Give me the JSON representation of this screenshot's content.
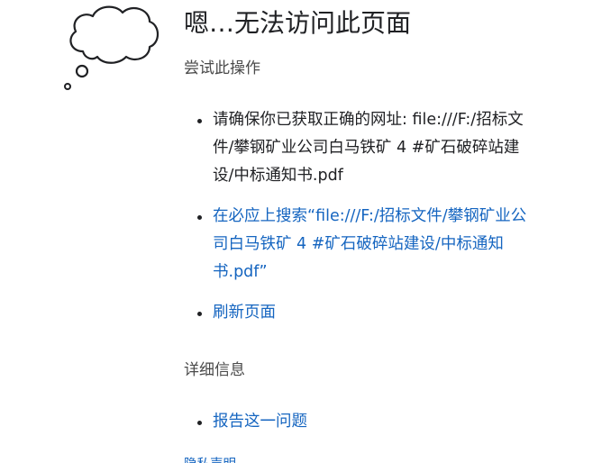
{
  "error_page": {
    "title": "嗯…无法访问此页面",
    "try_heading": "尝试此操作",
    "suggestions": [
      {
        "text": "请确保你已获取正确的网址: file:///F:/招标文件/攀钢矿业公司白马铁矿 4 #矿石破碎站建设/中标通知书.pdf",
        "is_link": false
      },
      {
        "text": "在必应上搜索“file:///F:/招标文件/攀钢矿业公司白马铁矿 4 #矿石破碎站建设/中标通知书.pdf”",
        "is_link": true
      },
      {
        "text": "刷新页面",
        "is_link": true
      }
    ],
    "details_heading": "详细信息",
    "details_items": [
      {
        "text": "报告这一问题",
        "is_link": true
      }
    ],
    "privacy_link": "隐私声明"
  },
  "colors": {
    "link": "#1565c0",
    "text": "#202124",
    "subtle": "#4a4a4a"
  },
  "icons": {
    "hero": "thought-bubble-icon"
  }
}
